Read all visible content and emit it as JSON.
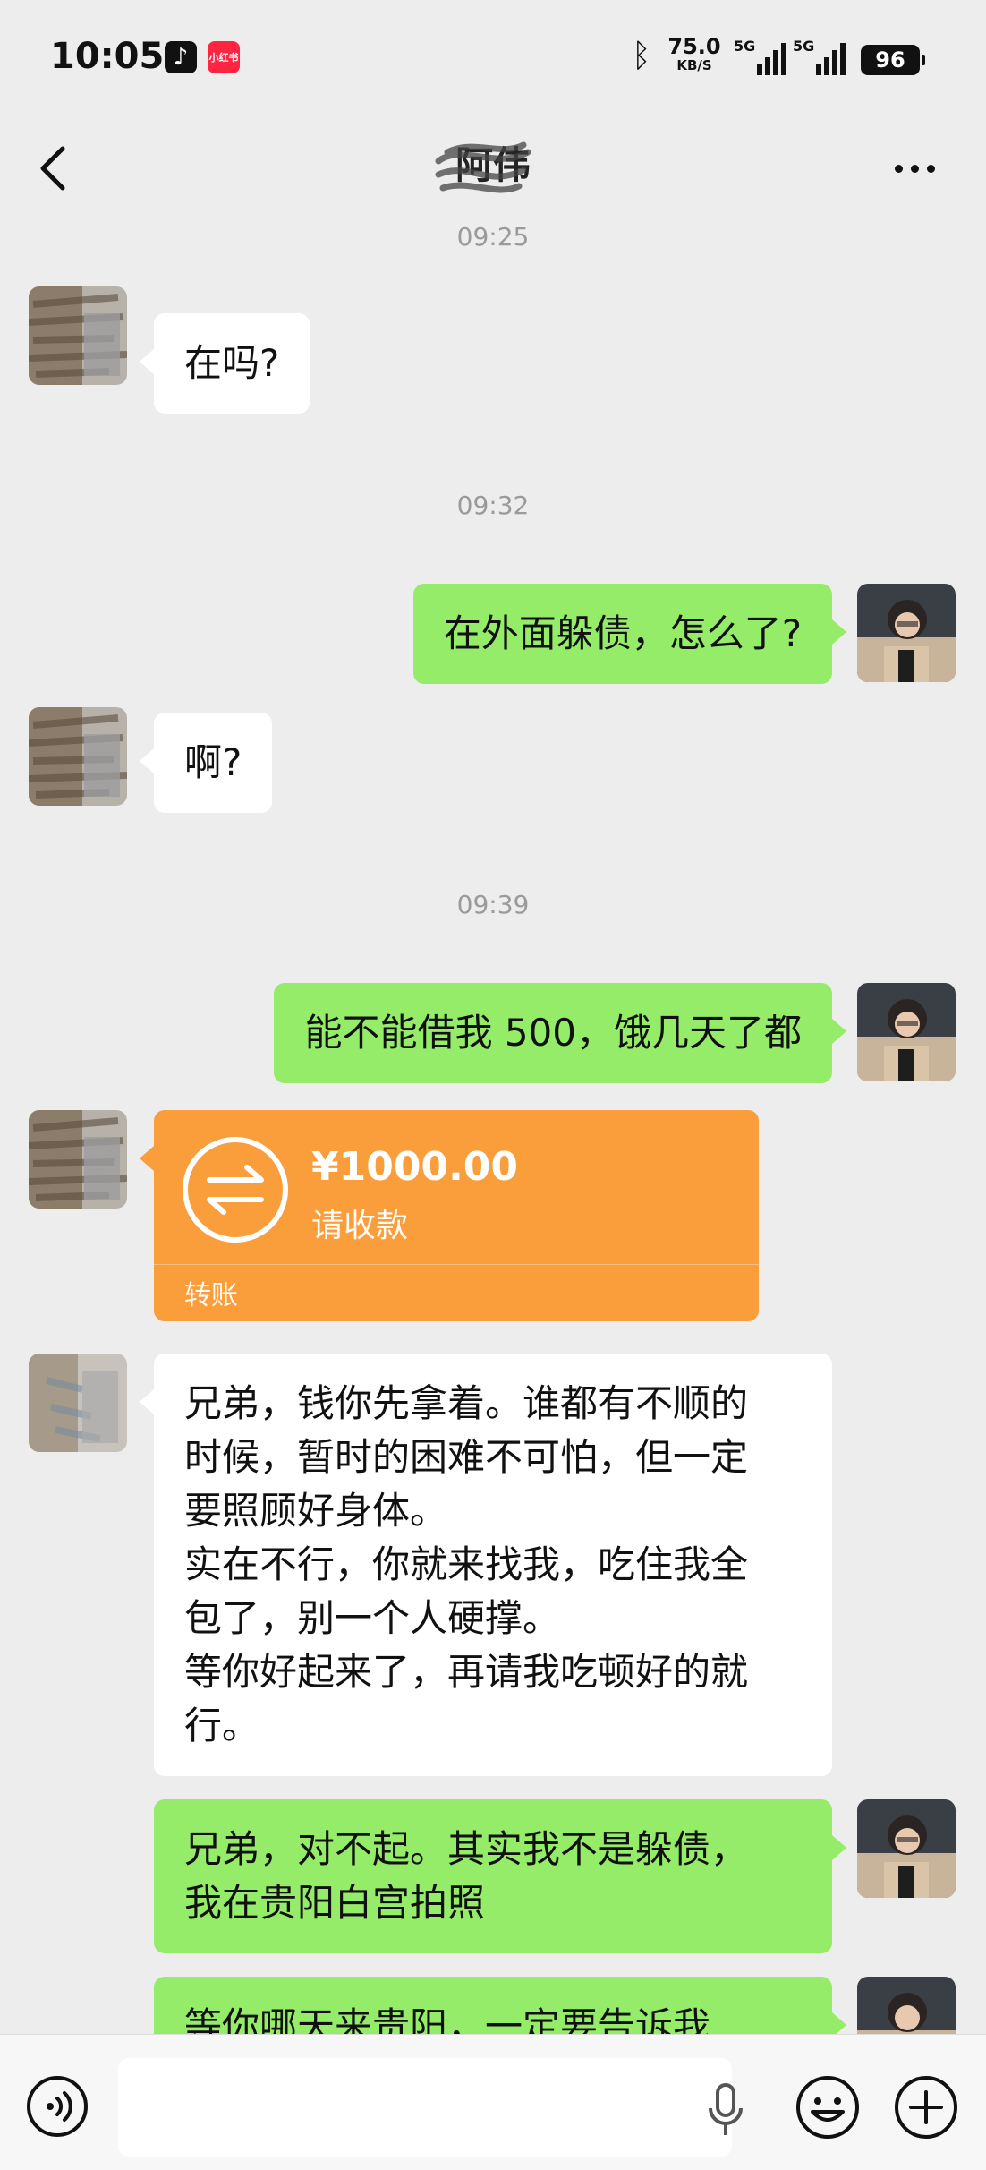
{
  "status_bar": {
    "time": "10:05",
    "app_icons": [
      "tiktok-icon",
      "xiaohongshu-icon"
    ],
    "xiaohongshu_label": "小红书",
    "net_speed_value": "75.0",
    "net_speed_unit": "KB/S",
    "signal_1_label": "5G",
    "signal_2_label": "5G",
    "battery": "96"
  },
  "header": {
    "title": "阿伟"
  },
  "messages": {
    "t1": "09:25",
    "m1": "在吗?",
    "t2": "09:32",
    "m2": "在外面躲债，怎么了?",
    "m3": "啊?",
    "t3": "09:39",
    "m4": "能不能借我 500，饿几天了都",
    "transfer": {
      "amount": "¥1000.00",
      "status": "请收款",
      "type": "转账"
    },
    "m6": "兄弟，钱你先拿着。谁都有不顺的\n时候，暂时的困难不可怕，但一定\n要照顾好身体。\n实在不行，你就来找我，吃住我全\n包了，别一个人硬撑。\n等你好起来了，再请我吃顿好的就\n行。",
    "m7": "兄弟，对不起。其实我不是躲债，\n我在贵阳白宫拍照",
    "m8": "等你哪天来贵阳，一定要告诉我"
  },
  "colors": {
    "background": "#ededed",
    "outgoing_bubble": "#95ec69",
    "incoming_bubble": "#ffffff",
    "transfer_card": "#fa9d3b",
    "timestamp_text": "#9a9a9a"
  },
  "input_bar": {
    "placeholder": "",
    "icons": [
      "voice-icon",
      "microphone-icon",
      "emoji-icon",
      "plus-icon"
    ]
  }
}
